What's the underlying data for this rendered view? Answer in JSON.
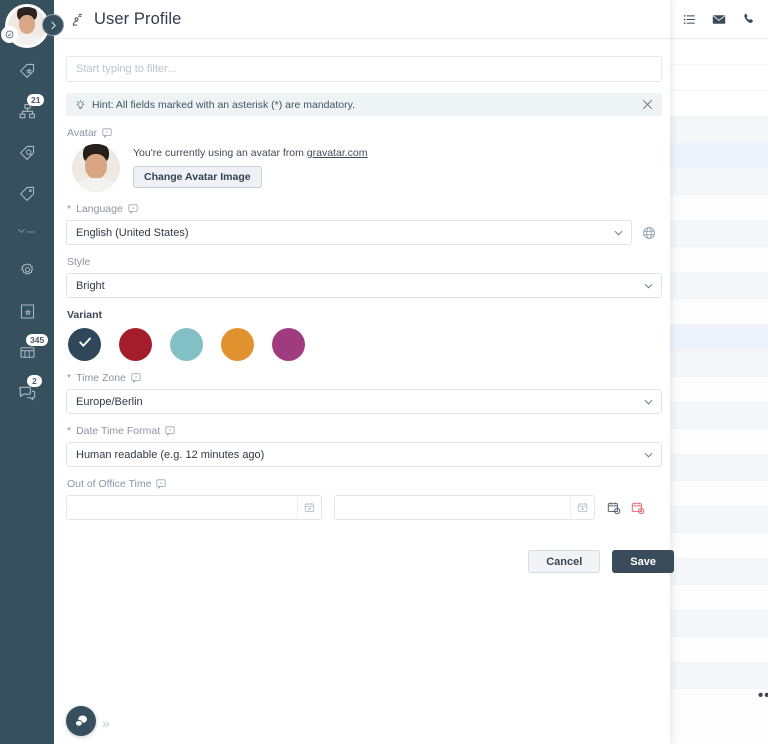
{
  "window": {
    "title": "User Profile",
    "title_icon": "user-profile-icon"
  },
  "topbar": {
    "icons": [
      {
        "name": "plus-icon",
        "glyph": "+"
      },
      {
        "name": "list-icon",
        "glyph": "list"
      },
      {
        "name": "mail-icon",
        "glyph": "mail"
      },
      {
        "name": "phone-icon",
        "glyph": "phone"
      }
    ],
    "overflow_label": "•••"
  },
  "sidebar": {
    "avatar_name": "user-avatar",
    "toggle_label": "›",
    "items": [
      {
        "name": "sidebar-item-tickets",
        "icon": "tag-star-icon",
        "badge": ""
      },
      {
        "name": "sidebar-item-organization",
        "icon": "org-chart-icon",
        "badge": "21"
      },
      {
        "name": "sidebar-item-search",
        "icon": "tag-search-icon",
        "badge": ""
      },
      {
        "name": "sidebar-item-tags",
        "icon": "tag-icon",
        "badge": ""
      },
      {
        "name": "sidebar-item-divider",
        "icon": "collapse-icon",
        "badge": ""
      },
      {
        "name": "sidebar-item-settings",
        "icon": "gear-icon",
        "badge": ""
      },
      {
        "name": "sidebar-item-knowledge-base",
        "icon": "document-star-icon",
        "badge": ""
      },
      {
        "name": "sidebar-item-overviews",
        "icon": "table-icon",
        "badge": "345"
      },
      {
        "name": "sidebar-item-chat",
        "icon": "chat-bubbles-icon",
        "badge": "2"
      }
    ]
  },
  "form": {
    "filter": {
      "placeholder": "Start typing to filter...",
      "value": ""
    },
    "hint": {
      "icon": "lightbulb-icon",
      "text": "Hint: All fields marked with an asterisk (*) are mandatory.",
      "close_label": "×"
    },
    "avatar": {
      "label": "Avatar",
      "note_prefix": "You're currently using an avatar from ",
      "note_link": "gravatar.com",
      "change_button": "Change Avatar Image"
    },
    "language": {
      "label": "Language",
      "required_mark": "*",
      "value": "English (United States)",
      "globe_icon": "globe-icon"
    },
    "style": {
      "label": "Style",
      "value": "Bright"
    },
    "variant": {
      "label": "Variant",
      "selected_index": 0,
      "swatches": [
        {
          "name": "variant-swatch-dark",
          "color": "#30475a",
          "selected": true
        },
        {
          "name": "variant-swatch-red",
          "color": "#a41d2b",
          "selected": false
        },
        {
          "name": "variant-swatch-teal",
          "color": "#83c0c6",
          "selected": false
        },
        {
          "name": "variant-swatch-orange",
          "color": "#e2912f",
          "selected": false
        },
        {
          "name": "variant-swatch-magenta",
          "color": "#a03b7f",
          "selected": false
        }
      ],
      "check_glyph": "✓"
    },
    "timezone": {
      "label": "Time Zone",
      "required_mark": "*",
      "value": "Europe/Berlin"
    },
    "datetime_format": {
      "label": "Date Time Format",
      "required_mark": "*",
      "value": "Human readable (e.g. 12 minutes ago)"
    },
    "out_of_office": {
      "label": "Out of Office Time",
      "start_value": "",
      "end_value": "",
      "start_placeholder": "",
      "end_placeholder": "",
      "calendar_icon": "calendar-icon",
      "set_icon": "calendar-set-icon",
      "clear_icon": "calendar-clear-icon"
    },
    "actions": {
      "cancel_label": "Cancel",
      "save_label": "Save"
    }
  },
  "chat": {
    "fab_icon": "chat-bubbles-icon",
    "expand_label": "»"
  },
  "colors": {
    "rail_bg": "#37505e",
    "accent": "#3a4c5c",
    "hint_bg": "#eef3f5"
  }
}
